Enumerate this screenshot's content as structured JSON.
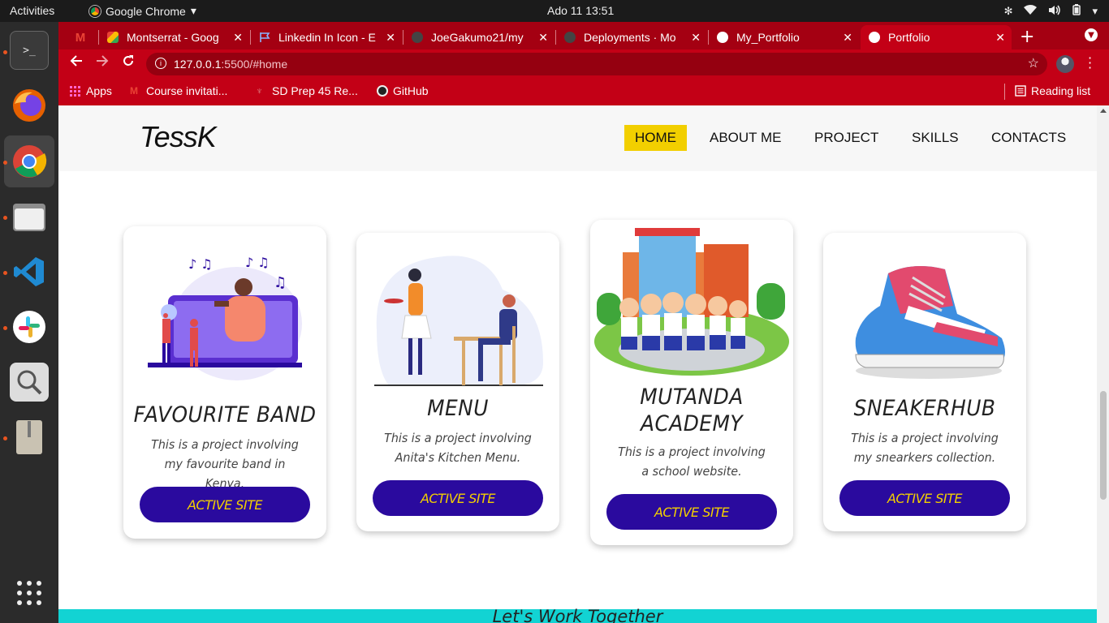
{
  "system_bar": {
    "activities": "Activities",
    "app_name": "Google Chrome",
    "clock": "Ado 11  13:51"
  },
  "dock": {
    "items": [
      "terminal-icon",
      "firefox-icon",
      "chrome-icon",
      "files-icon",
      "vscode-icon",
      "slack-icon",
      "magnifier-icon",
      "archive-icon",
      "show-apps-icon"
    ]
  },
  "browser": {
    "tabs": [
      {
        "label": "",
        "icon": "gmail-icon"
      },
      {
        "label": "Montserrat - Goog",
        "icon": "google-fonts-icon"
      },
      {
        "label": "Linkedin In Icon - E",
        "icon": "flag-icon"
      },
      {
        "label": "JoeGakumo21/my",
        "icon": "github-icon"
      },
      {
        "label": "Deployments · Mo",
        "icon": "github-icon"
      },
      {
        "label": "My_Portfolio",
        "icon": "globe-icon"
      },
      {
        "label": "Portfolio",
        "icon": "globe-icon"
      }
    ],
    "url_host": "127.0.0.1",
    "url_path": ":5500/#home",
    "bookmarks": {
      "apps": "Apps",
      "items": [
        "Course invitati...",
        "SD Prep 45 Re...",
        "GitHub"
      ],
      "reading_list": "Reading list"
    }
  },
  "site": {
    "logo": "TessK",
    "menu": [
      "HOME",
      "ABOUT ME",
      "PROJECT",
      "SKILLS",
      "CONTACTS"
    ],
    "active_menu": "HOME",
    "cards": [
      {
        "title": "FAVOURITE BAND",
        "desc": "This is a project involving my favourite band in Kenya.",
        "button": "ACTIVE SITE"
      },
      {
        "title": "MENU",
        "desc": "This is a project involving Anita's Kitchen Menu.",
        "button": "ACTIVE SITE"
      },
      {
        "title": "MUTANDA ACADEMY",
        "desc": "This is a project involving a school website.",
        "button": "ACTIVE SITE"
      },
      {
        "title": "SNEAKERHUB",
        "desc": "This is a project involving my snearkers collection.",
        "button": "ACTIVE SITE"
      }
    ],
    "footer_heading": "Let's Work Together"
  },
  "colors": {
    "chrome_frame": "#a40012",
    "active_menu_bg": "#f2cf00",
    "button_bg": "#2a0a9e",
    "button_text": "#f2cf00",
    "footer_band": "#12d3d3"
  }
}
